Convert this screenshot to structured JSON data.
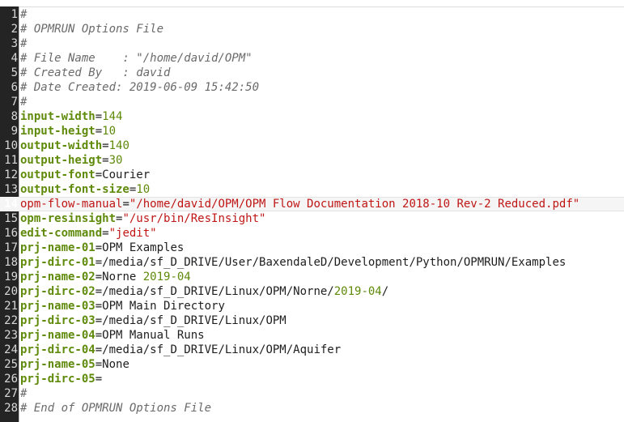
{
  "editor": {
    "colors": {
      "gutter": "#242424",
      "comment": "#6a6a6a",
      "key": "#5f8a0a",
      "number": "#5f8a0a",
      "string": "#c01616",
      "plain": "#1e1e1e"
    },
    "current_line": 14,
    "lines": [
      {
        "n": "1",
        "segs": [
          {
            "t": "#",
            "c": "comment"
          }
        ]
      },
      {
        "n": "2",
        "segs": [
          {
            "t": "# OPMRUN Options File",
            "c": "comment"
          }
        ]
      },
      {
        "n": "3",
        "segs": [
          {
            "t": "#",
            "c": "comment"
          }
        ]
      },
      {
        "n": "4",
        "segs": [
          {
            "t": "# File Name    : \"/home/david/OPM\"",
            "c": "comment"
          }
        ]
      },
      {
        "n": "5",
        "segs": [
          {
            "t": "# Created By   : david",
            "c": "comment"
          }
        ]
      },
      {
        "n": "6",
        "segs": [
          {
            "t": "# Date Created: 2019-06-09 15:42:50",
            "c": "comment"
          }
        ]
      },
      {
        "n": "7",
        "segs": [
          {
            "t": "#",
            "c": "comment"
          }
        ]
      },
      {
        "n": "8",
        "segs": [
          {
            "t": "input-width",
            "c": "key"
          },
          {
            "t": "=",
            "c": "plain"
          },
          {
            "t": "144",
            "c": "number"
          }
        ]
      },
      {
        "n": "9",
        "segs": [
          {
            "t": "input-heigt",
            "c": "key"
          },
          {
            "t": "=",
            "c": "plain"
          },
          {
            "t": "10",
            "c": "number"
          }
        ]
      },
      {
        "n": "10",
        "segs": [
          {
            "t": "output-width",
            "c": "key"
          },
          {
            "t": "=",
            "c": "plain"
          },
          {
            "t": "140",
            "c": "number"
          }
        ]
      },
      {
        "n": "11",
        "segs": [
          {
            "t": "output-heigt",
            "c": "key"
          },
          {
            "t": "=",
            "c": "plain"
          },
          {
            "t": "30",
            "c": "number"
          }
        ]
      },
      {
        "n": "12",
        "segs": [
          {
            "t": "output-font",
            "c": "key"
          },
          {
            "t": "=",
            "c": "plain"
          },
          {
            "t": "Courier",
            "c": "plain"
          }
        ]
      },
      {
        "n": "13",
        "segs": [
          {
            "t": "output-font-size",
            "c": "key"
          },
          {
            "t": "=",
            "c": "plain"
          },
          {
            "t": "10",
            "c": "number"
          }
        ]
      },
      {
        "n": "14",
        "segs": [
          {
            "t": "opm-flow-manual",
            "c": "key-current"
          },
          {
            "t": "=",
            "c": "plain"
          },
          {
            "t": "\"/home/david/OPM/OPM Flow Documentation 2018-10 Rev-2 Reduced.pdf\"",
            "c": "string"
          }
        ]
      },
      {
        "n": "15",
        "segs": [
          {
            "t": "opm-resinsight",
            "c": "key"
          },
          {
            "t": "=",
            "c": "plain"
          },
          {
            "t": "\"/usr/bin/ResInsight\"",
            "c": "string"
          }
        ]
      },
      {
        "n": "16",
        "segs": [
          {
            "t": "edit-command",
            "c": "key"
          },
          {
            "t": "=",
            "c": "plain"
          },
          {
            "t": "\"jedit\"",
            "c": "string"
          }
        ]
      },
      {
        "n": "17",
        "segs": [
          {
            "t": "prj-name-01",
            "c": "key"
          },
          {
            "t": "=",
            "c": "plain"
          },
          {
            "t": "OPM Examples",
            "c": "plain"
          }
        ]
      },
      {
        "n": "18",
        "segs": [
          {
            "t": "prj-dirc-01",
            "c": "key"
          },
          {
            "t": "=",
            "c": "plain"
          },
          {
            "t": "/media/sf_D_DRIVE/User/BaxendaleD/Development/Python/OPMRUN/Examples",
            "c": "plain"
          }
        ]
      },
      {
        "n": "19",
        "segs": [
          {
            "t": "prj-name-02",
            "c": "key"
          },
          {
            "t": "=",
            "c": "plain"
          },
          {
            "t": "Norne ",
            "c": "plain"
          },
          {
            "t": "2019-04",
            "c": "number"
          }
        ]
      },
      {
        "n": "20",
        "segs": [
          {
            "t": "prj-dirc-02",
            "c": "key"
          },
          {
            "t": "=",
            "c": "plain"
          },
          {
            "t": "/media/sf_D_DRIVE/Linux/OPM/Norne/",
            "c": "plain"
          },
          {
            "t": "2019-04",
            "c": "number"
          },
          {
            "t": "/",
            "c": "plain"
          }
        ]
      },
      {
        "n": "21",
        "segs": [
          {
            "t": "prj-name-03",
            "c": "key"
          },
          {
            "t": "=",
            "c": "plain"
          },
          {
            "t": "OPM Main Directory",
            "c": "plain"
          }
        ]
      },
      {
        "n": "22",
        "segs": [
          {
            "t": "prj-dirc-03",
            "c": "key"
          },
          {
            "t": "=",
            "c": "plain"
          },
          {
            "t": "/media/sf_D_DRIVE/Linux/OPM",
            "c": "plain"
          }
        ]
      },
      {
        "n": "23",
        "segs": [
          {
            "t": "prj-name-04",
            "c": "key"
          },
          {
            "t": "=",
            "c": "plain"
          },
          {
            "t": "OPM Manual Runs",
            "c": "plain"
          }
        ]
      },
      {
        "n": "24",
        "segs": [
          {
            "t": "prj-dirc-04",
            "c": "key"
          },
          {
            "t": "=",
            "c": "plain"
          },
          {
            "t": "/media/sf_D_DRIVE/Linux/OPM/Aquifer",
            "c": "plain"
          }
        ]
      },
      {
        "n": "25",
        "segs": [
          {
            "t": "prj-name-05",
            "c": "key"
          },
          {
            "t": "=",
            "c": "plain"
          },
          {
            "t": "None",
            "c": "plain"
          }
        ]
      },
      {
        "n": "26",
        "segs": [
          {
            "t": "prj-dirc-05",
            "c": "key"
          },
          {
            "t": "=",
            "c": "plain"
          }
        ]
      },
      {
        "n": "27",
        "segs": [
          {
            "t": "#",
            "c": "comment"
          }
        ]
      },
      {
        "n": "28",
        "segs": [
          {
            "t": "# End of OPMRUN Options File",
            "c": "comment"
          }
        ]
      }
    ]
  }
}
